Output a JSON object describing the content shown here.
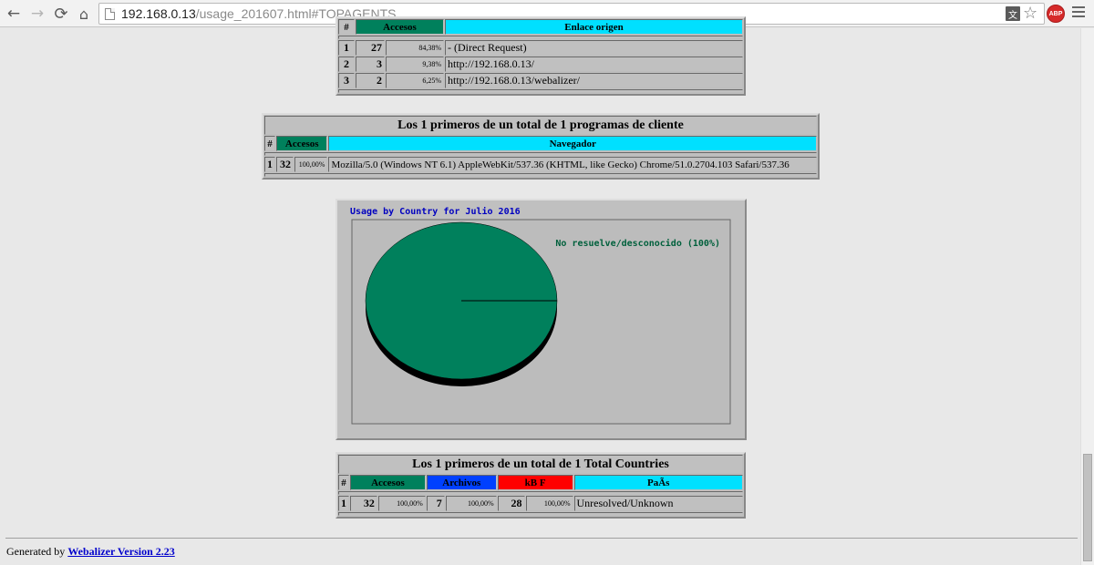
{
  "browser": {
    "url_host": "192.168.0.13",
    "url_path": "/usage_201607.html#TOPAGENTS",
    "back_glyph": "←",
    "forward_glyph": "→",
    "reload_glyph": "⟳",
    "home_glyph": "⌂",
    "translate_glyph": "文",
    "star_glyph": "☆",
    "adblock_label": "ABP"
  },
  "referrers": {
    "headers": {
      "index": "#",
      "hits": "Accesos",
      "referrer": "Enlace origen"
    },
    "rows": [
      {
        "index": "1",
        "hits": "27",
        "pct": "84,38%",
        "referrer": "- (Direct Request)"
      },
      {
        "index": "2",
        "hits": "3",
        "pct": "9,38%",
        "referrer": "http://192.168.0.13/"
      },
      {
        "index": "3",
        "hits": "2",
        "pct": "6,25%",
        "referrer": "http://192.168.0.13/webalizer/"
      }
    ]
  },
  "agents": {
    "title": "Los 1 primeros de un total de 1 programas de cliente",
    "headers": {
      "index": "#",
      "hits": "Accesos",
      "browser": "Navegador"
    },
    "rows": [
      {
        "index": "1",
        "hits": "32",
        "pct": "100,00%",
        "browser": "Mozilla/5.0 (Windows NT 6.1) AppleWebKit/537.36 (KHTML, like Gecko) Chrome/51.0.2704.103 Safari/537.36"
      }
    ]
  },
  "chart_data": {
    "type": "pie",
    "title": "Usage by Country for Julio 2016",
    "slices": [
      {
        "label": "No resuelve/desconocido (100%)",
        "value": 100,
        "color": "#00805c"
      }
    ]
  },
  "countries": {
    "title": "Los 1 primeros de un total de 1 Total Countries",
    "headers": {
      "index": "#",
      "hits": "Accesos",
      "files": "Archivos",
      "kbytes": "kB F",
      "country": "PaÃs"
    },
    "rows": [
      {
        "index": "1",
        "hits": "32",
        "hits_pct": "100,00%",
        "files": "7",
        "files_pct": "100,00%",
        "kbytes": "28",
        "kbytes_pct": "100,00%",
        "country": "Unresolved/Unknown"
      }
    ]
  },
  "footer": {
    "prefix": "Generated by",
    "link": "Webalizer Version 2.23"
  },
  "colors": {
    "hits": "#00805c",
    "files": "#0040ff",
    "kbytes": "#ff0000",
    "label": "#00e0ff"
  }
}
